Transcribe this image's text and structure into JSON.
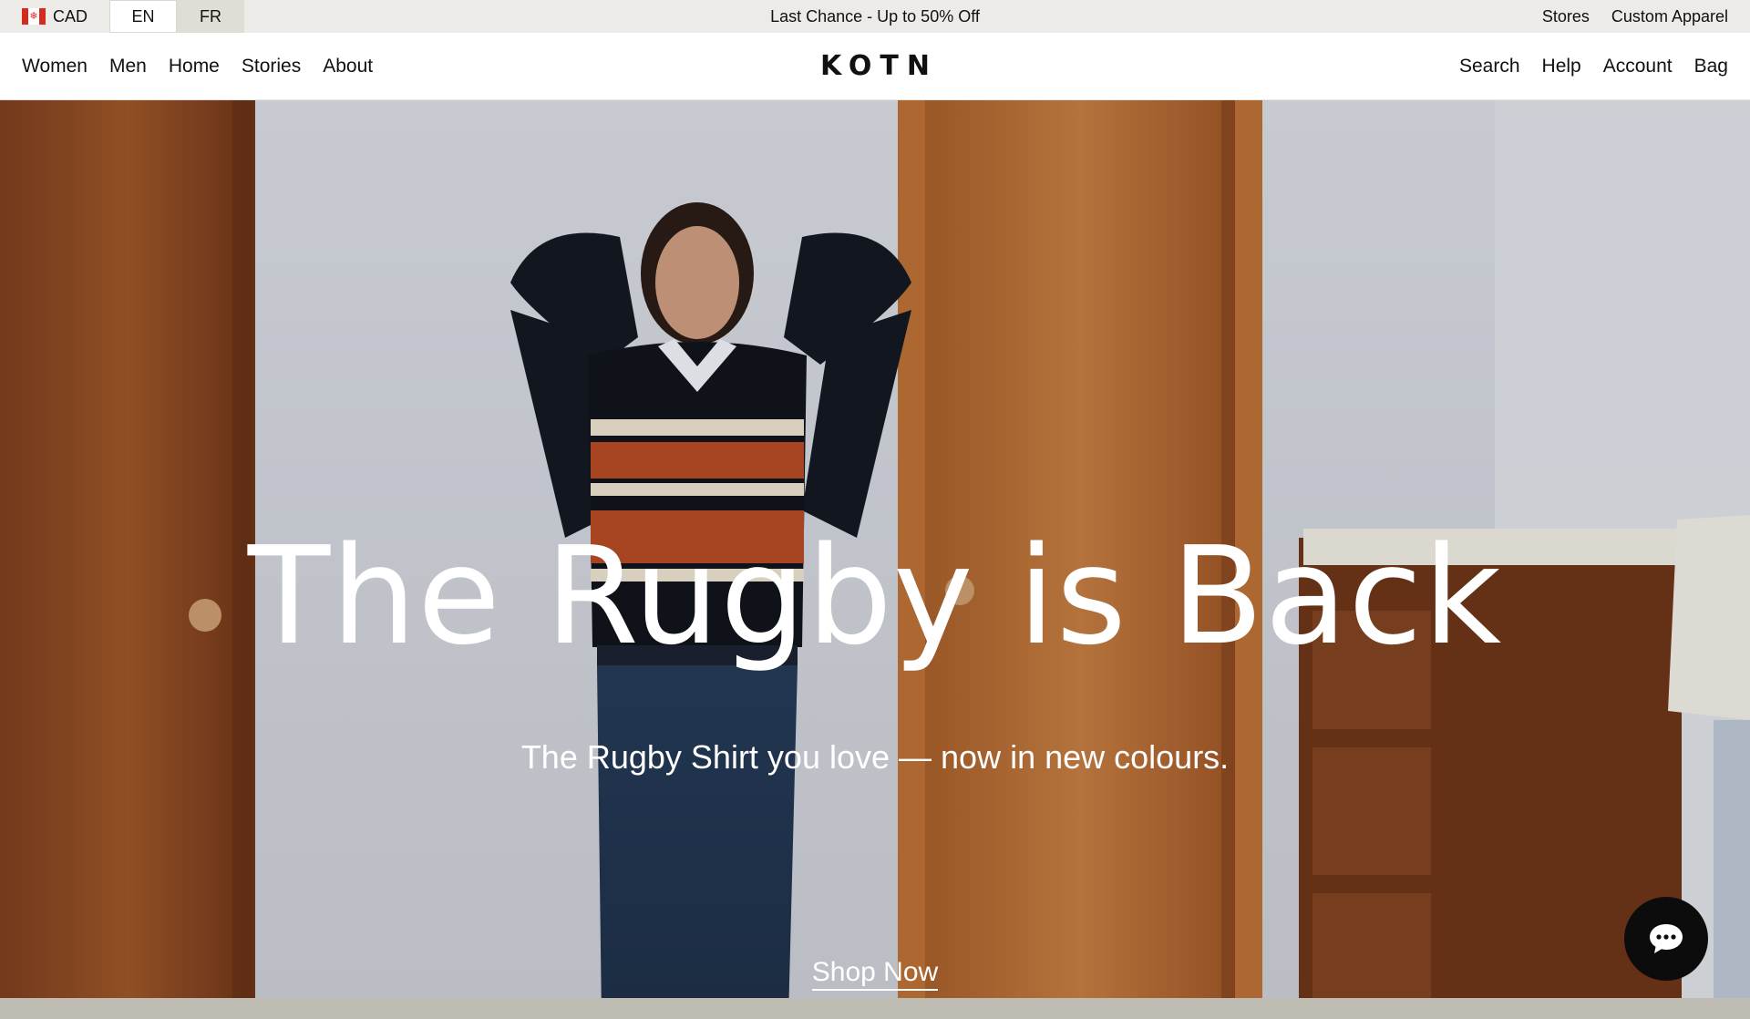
{
  "locale": {
    "currency": "CAD",
    "flag_icon": "canada-flag-icon",
    "languages": [
      {
        "label": "EN",
        "active": true
      },
      {
        "label": "FR",
        "active": false
      }
    ]
  },
  "announcement": {
    "text": "Last Chance - Up to 50% Off"
  },
  "utility_links": [
    {
      "label": "Stores"
    },
    {
      "label": "Custom Apparel"
    }
  ],
  "nav": {
    "logo": "KOTN",
    "left": [
      {
        "label": "Women"
      },
      {
        "label": "Men"
      },
      {
        "label": "Home"
      },
      {
        "label": "Stories"
      },
      {
        "label": "About"
      }
    ],
    "right": [
      {
        "label": "Search"
      },
      {
        "label": "Help"
      },
      {
        "label": "Account"
      },
      {
        "label": "Bag"
      }
    ]
  },
  "hero": {
    "headline": "The Rugby is Back",
    "subheadline": "The Rugby Shirt you love — now in new colours.",
    "cta": "Shop Now",
    "image_description": "model-in-striped-rugby-shirt-leaning-on-wall"
  },
  "chat": {
    "icon": "chat-bubble-icon"
  },
  "colors": {
    "topbar_bg": "#ecebe8",
    "text": "#111111",
    "hero_text": "#ffffff",
    "chat_bg": "#0c0c0c",
    "flag_red": "#d52b1e"
  }
}
